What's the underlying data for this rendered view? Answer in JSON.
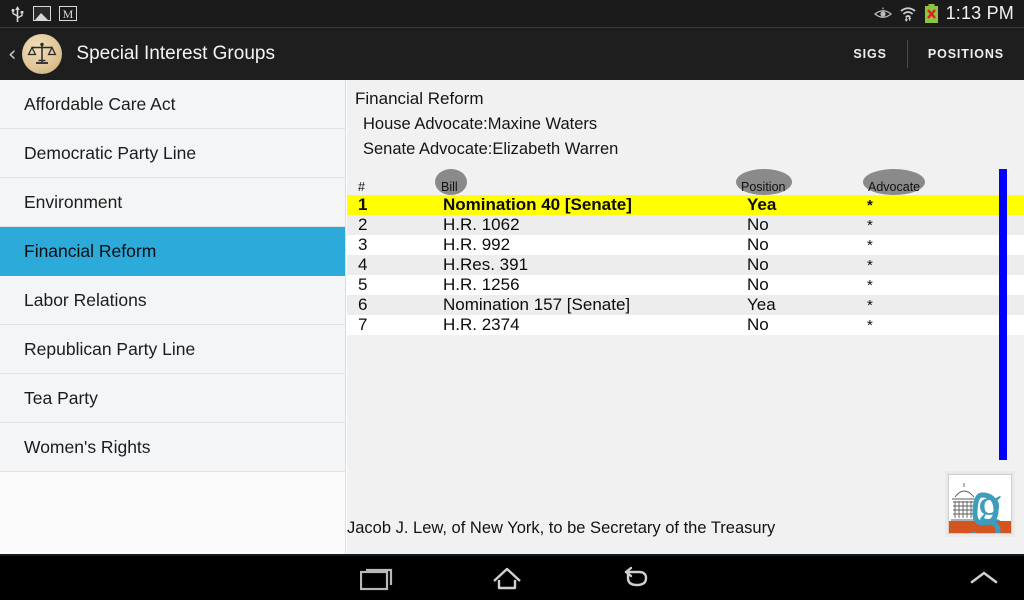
{
  "statusbar": {
    "icons": [
      "usb-icon",
      "gallery-icon",
      "gmail-icon"
    ],
    "right_icons": [
      "eye-icon",
      "wifi-icon",
      "battery-error-icon"
    ],
    "clock": "1:13 PM"
  },
  "appbar": {
    "back_label": "‹",
    "logo_name": "scales-of-justice-logo",
    "title": "Special Interest Groups",
    "tabs": [
      {
        "label": "SIGS"
      },
      {
        "label": "POSITIONS"
      }
    ]
  },
  "sidebar": {
    "items": [
      {
        "label": "Affordable Care Act",
        "selected": false
      },
      {
        "label": "Democratic Party Line",
        "selected": false
      },
      {
        "label": "Environment",
        "selected": false
      },
      {
        "label": "Financial Reform",
        "selected": true
      },
      {
        "label": "Labor Relations",
        "selected": false
      },
      {
        "label": "Republican Party Line",
        "selected": false
      },
      {
        "label": "Tea Party",
        "selected": false
      },
      {
        "label": "Women's Rights",
        "selected": false
      }
    ]
  },
  "main": {
    "title": "Financial Reform",
    "house_advocate": "House Advocate:Maxine Waters",
    "senate_advocate": "Senate Advocate:Elizabeth Warren",
    "columns": [
      "#",
      "Bill",
      "Position",
      "Advocate"
    ],
    "rows": [
      {
        "num": "1",
        "bill": "Nomination 40 [Senate]",
        "position": "Yea",
        "advocate": "*",
        "highlighted": true
      },
      {
        "num": "2",
        "bill": "H.R. 1062",
        "position": "No",
        "advocate": "*",
        "highlighted": false
      },
      {
        "num": "3",
        "bill": "H.R. 992",
        "position": "No",
        "advocate": "*",
        "highlighted": false
      },
      {
        "num": "4",
        "bill": "H.Res. 391",
        "position": "No",
        "advocate": "*",
        "highlighted": false
      },
      {
        "num": "5",
        "bill": "H.R. 1256",
        "position": "No",
        "advocate": "*",
        "highlighted": false
      },
      {
        "num": "6",
        "bill": "Nomination 157 [Senate]",
        "position": "Yea",
        "advocate": "*",
        "highlighted": false
      },
      {
        "num": "7",
        "bill": "H.R. 2374",
        "position": "No",
        "advocate": "*",
        "highlighted": false
      }
    ],
    "footnote": "Jacob J. Lew, of New York, to be Secretary of the Treasury",
    "logo_name": "govtrack-capitol-g-logo"
  },
  "navbar": {
    "buttons": [
      "recents-icon",
      "home-icon",
      "back-icon",
      "chevron-up-icon"
    ]
  },
  "colors": {
    "accent": "#2cabdb",
    "highlight": "#ffff00",
    "scrollbar": "#0000ff",
    "statusbar_bg": "#1b1b1b",
    "appbar_bg": "#1e1e1e",
    "badge": "#8a8a8a"
  }
}
